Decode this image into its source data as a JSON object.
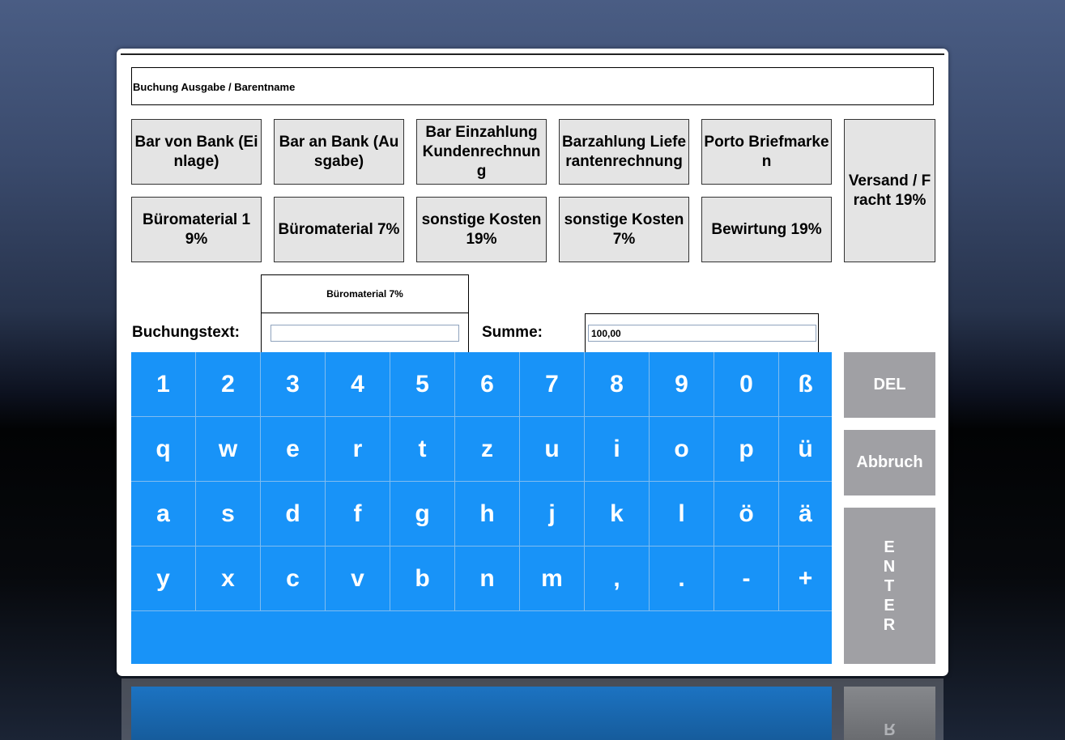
{
  "title": "Buchung Ausgabe / Barentname",
  "categories_row1": [
    "Bar von Bank (Einlage)",
    "Bar an Bank (Ausgabe)",
    "Bar Einzahlung Kundenrechnung",
    "Barzahlung Lieferantenrechnung",
    "Porto Briefmarken"
  ],
  "categories_row2": [
    "Büromaterial 19%",
    "Büromaterial 7%",
    "sonstige Kosten 19%",
    "sonstige Kosten 7%",
    "Bewirtung 19%"
  ],
  "category_tall": "Versand / Fracht 19%",
  "selected_category": "Büromaterial 7%",
  "buchungstext_label": "Buchungstext:",
  "buchungstext_value": "",
  "summe_label": "Summe:",
  "summe_value": "100,00",
  "keyboard_rows": [
    [
      "1",
      "2",
      "3",
      "4",
      "5",
      "6",
      "7",
      "8",
      "9",
      "0",
      "ß"
    ],
    [
      "q",
      "w",
      "e",
      "r",
      "t",
      "z",
      "u",
      "i",
      "o",
      "p",
      "ü"
    ],
    [
      "a",
      "s",
      "d",
      "f",
      "g",
      "h",
      "j",
      "k",
      "l",
      "ö",
      "ä"
    ],
    [
      "y",
      "x",
      "c",
      "v",
      "b",
      "n",
      "m",
      ",",
      ".",
      "-",
      "+"
    ]
  ],
  "del_label": "DEL",
  "abbruch_label": "Abbruch",
  "enter_letters": [
    "E",
    "N",
    "T",
    "E",
    "R"
  ],
  "reflection_letter": "R",
  "colors": {
    "keyboard": "#1893f8",
    "category_button": "#e4e4e4",
    "side_button": "#a0a0a4"
  }
}
